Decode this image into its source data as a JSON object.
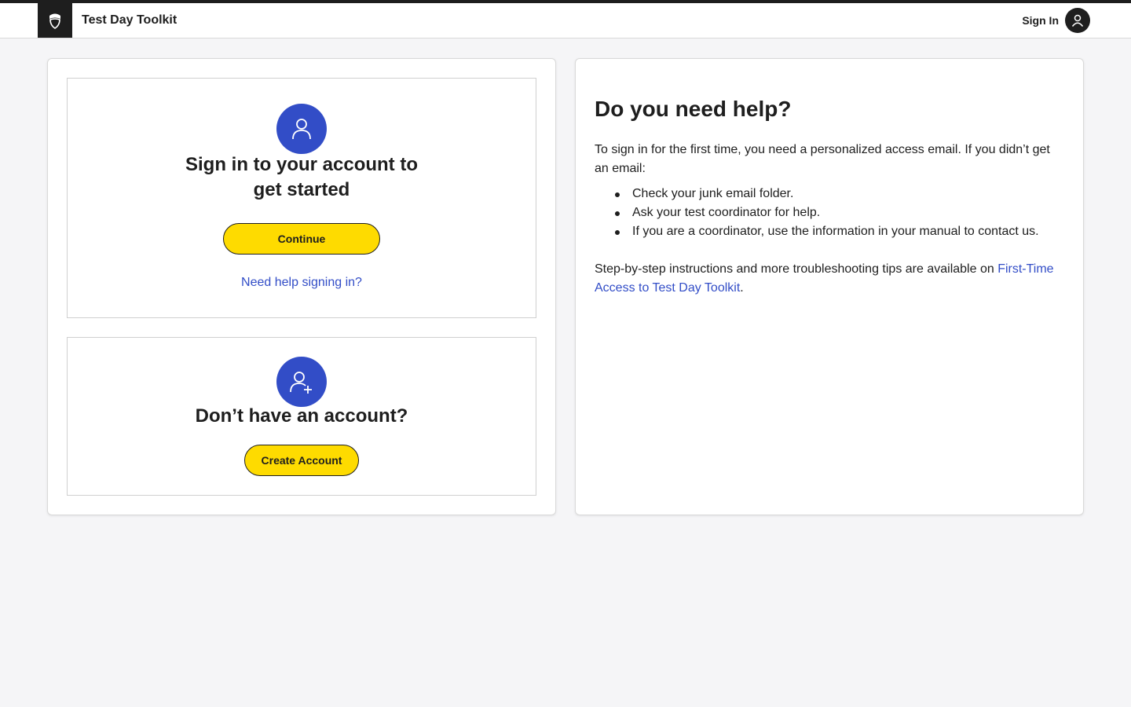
{
  "header": {
    "app_title": "Test Day Toolkit",
    "sign_in_label": "Sign In",
    "logo_icon": "acorn-icon",
    "avatar_icon": "user-icon"
  },
  "signin_card": {
    "icon": "user-icon",
    "heading": "Sign in to your account to get started",
    "continue_label": "Continue",
    "help_link": "Need help signing in?"
  },
  "create_card": {
    "icon": "add-user-icon",
    "heading": "Don’t have an account?",
    "create_label": "Create Account"
  },
  "help_panel": {
    "title": "Do you need help?",
    "intro": "To sign in for the first time, you need a personalized access email. If you didn’t get an email:",
    "items": [
      "Check your junk email folder.",
      "Ask your test coordinator for help.",
      "If you are a coordinator, use the information in your manual to contact us."
    ],
    "steps_text": "Step-by-step instructions and more troubleshooting tips are available on ",
    "steps_link": "First-Time Access to Test Day Toolkit",
    "steps_end": "."
  },
  "colors": {
    "accent_blue": "#324dc7",
    "button_yellow": "#fedb00",
    "header_black": "#1e1e1e",
    "page_bg": "#f5f5f7"
  }
}
